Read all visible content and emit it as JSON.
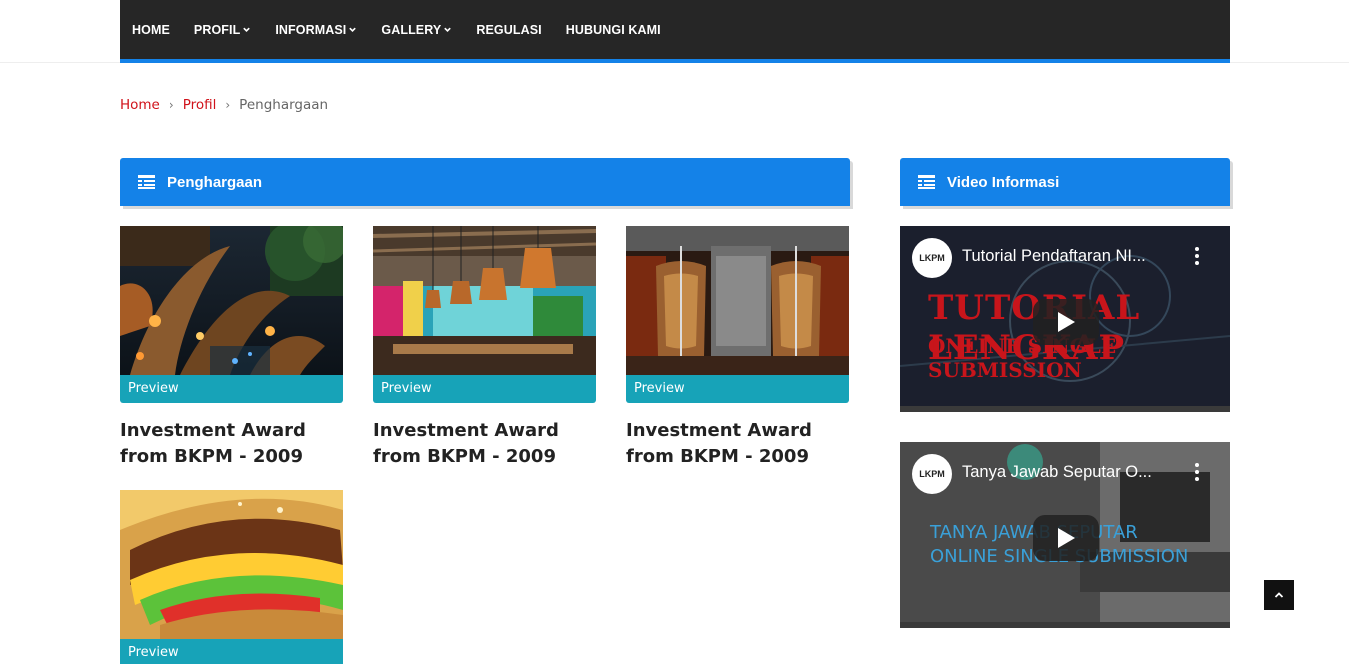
{
  "nav": {
    "items": [
      {
        "label": "HOME",
        "dropdown": false
      },
      {
        "label": "PROFIL",
        "dropdown": true
      },
      {
        "label": "INFORMASI",
        "dropdown": true
      },
      {
        "label": "GALLERY",
        "dropdown": true
      },
      {
        "label": "REGULASI",
        "dropdown": false
      },
      {
        "label": "HUBUNGI KAMI",
        "dropdown": false
      }
    ]
  },
  "breadcrumb": {
    "home": "Home",
    "profil": "Profil",
    "current": "Penghargaan",
    "separator": "›"
  },
  "main": {
    "section_title": "Penghargaan",
    "cards": [
      {
        "preview_label": "Preview",
        "title": "Investment Award from BKPM - 2009",
        "image": "restaurant-interior-sculpture"
      },
      {
        "preview_label": "Preview",
        "title": "Investment Award from BKPM - 2009",
        "image": "cafe-counter-lamps"
      },
      {
        "preview_label": "Preview",
        "title": "Investment Award from BKPM - 2009",
        "image": "kebab-grill"
      },
      {
        "preview_label": "Preview",
        "title": "",
        "image": "burger-closeup"
      }
    ]
  },
  "sidebar": {
    "section_title": "Video Informasi",
    "videos": [
      {
        "title": "Tutorial Pendaftaran NI...",
        "channel": "LKPM",
        "overlay_line1": "TUTORIAL LENGKAP",
        "overlay_line2": "ONLINE SINGLE SUBMISSION"
      },
      {
        "title": "Tanya Jawab Seputar O...",
        "channel": "LKPM",
        "overlay_line1": "TANYA JAWAB SEPUTAR",
        "overlay_line2": "ONLINE SINGLE SUBMISSION"
      }
    ]
  },
  "colors": {
    "nav_bg": "#262626",
    "accent_blue": "#1482e8",
    "preview_teal": "#17a3b8",
    "breadcrumb_link": "#d0121a"
  },
  "icons": {
    "section_icon": "list-icon",
    "back_to_top": "chevron-up-icon",
    "play": "play-icon",
    "video_menu": "more-vertical-icon",
    "nav_caret": "chevron-down-icon"
  }
}
